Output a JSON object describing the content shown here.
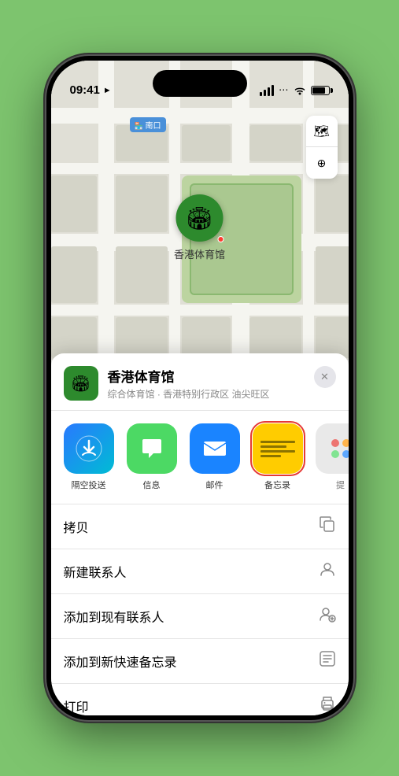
{
  "status": {
    "time": "09:41",
    "location_arrow": "▲"
  },
  "map": {
    "location_tag": "南口",
    "pin_label": "香港体育馆",
    "controls": {
      "map_icon": "🗺",
      "location_icon": "⌖"
    }
  },
  "venue": {
    "name": "香港体育馆",
    "subtitle": "综合体育馆 · 香港特别行政区 油尖旺区",
    "close_label": "✕"
  },
  "share_apps": [
    {
      "id": "airdrop",
      "label": "隔空投送"
    },
    {
      "id": "messages",
      "label": "信息"
    },
    {
      "id": "mail",
      "label": "邮件"
    },
    {
      "id": "notes",
      "label": "备忘录"
    },
    {
      "id": "more",
      "label": "提"
    }
  ],
  "actions": [
    {
      "label": "拷贝",
      "icon": "⧉"
    },
    {
      "label": "新建联系人",
      "icon": "👤"
    },
    {
      "label": "添加到现有联系人",
      "icon": "👤"
    },
    {
      "label": "添加到新快速备忘录",
      "icon": "⊡"
    },
    {
      "label": "打印",
      "icon": "🖨"
    }
  ],
  "colors": {
    "accent_green": "#2d8a2d",
    "accent_blue": "#1a84ff",
    "accent_red": "#e53935",
    "notes_yellow": "#ffcc00"
  }
}
